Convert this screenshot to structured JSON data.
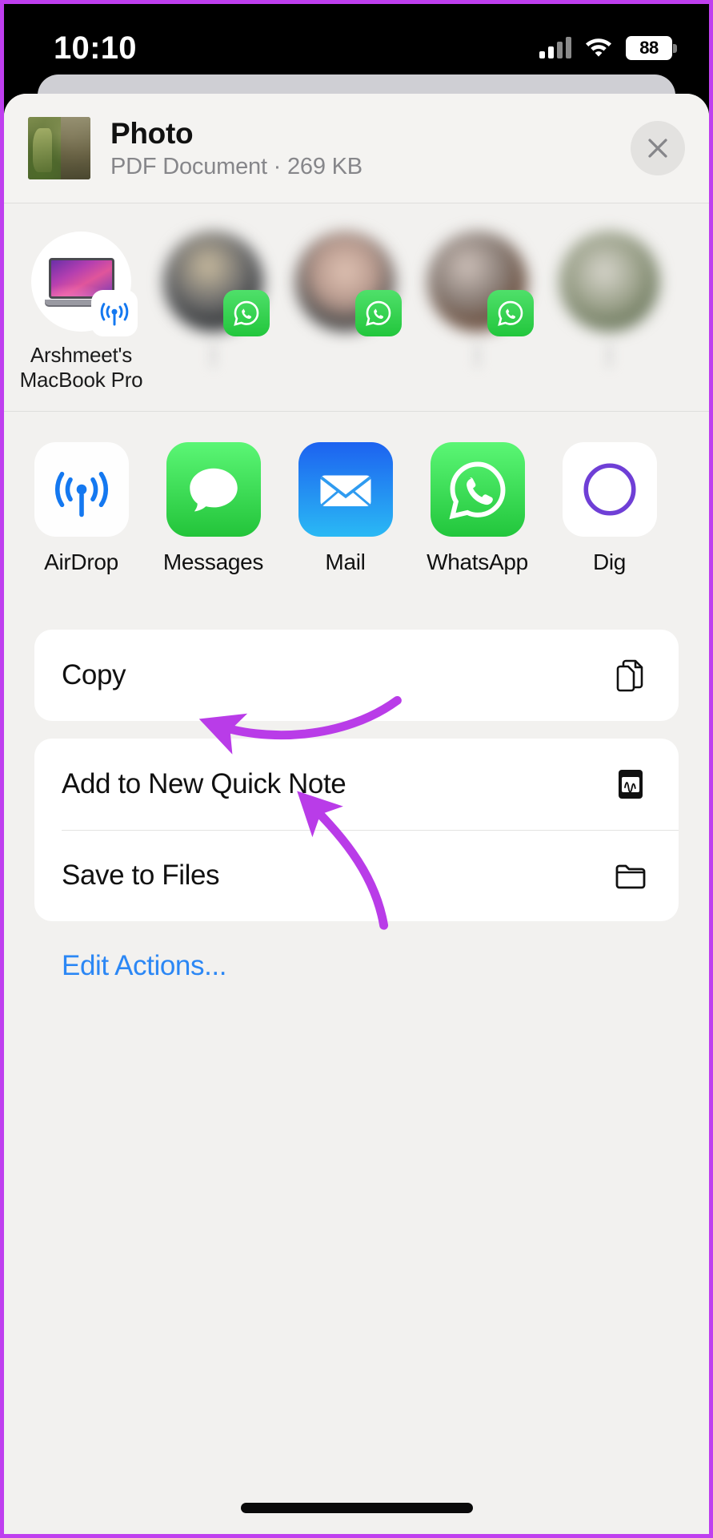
{
  "status_bar": {
    "time": "10:10",
    "battery_percent": "88",
    "cellular_icon": "cellular-signal-icon",
    "wifi_icon": "wifi-icon",
    "battery_icon": "battery-icon"
  },
  "share_sheet": {
    "document": {
      "title": "Photo",
      "subtitle": "PDF Document · 269 KB",
      "thumbnail_icon": "document-thumbnail"
    },
    "close_label": "Close",
    "people": [
      {
        "name": "Arshmeet's MacBook Pro",
        "badge": "airdrop-badge",
        "avatar": "macbook-pro-icon",
        "blurred": false
      },
      {
        "name": "",
        "badge": "whatsapp-badge",
        "avatar": "contact-photo",
        "blurred": true
      },
      {
        "name": "",
        "badge": "whatsapp-badge",
        "avatar": "contact-photo",
        "blurred": true
      },
      {
        "name": "",
        "badge": "whatsapp-badge",
        "avatar": "contact-photo",
        "blurred": true
      },
      {
        "name": "",
        "badge": "whatsapp-badge",
        "avatar": "contact-photo",
        "blurred": true
      }
    ],
    "apps": [
      {
        "label": "AirDrop",
        "icon": "airdrop-icon"
      },
      {
        "label": "Messages",
        "icon": "messages-icon"
      },
      {
        "label": "Mail",
        "icon": "mail-icon"
      },
      {
        "label": "WhatsApp",
        "icon": "whatsapp-icon"
      },
      {
        "label": "Dig",
        "icon": "digital-touch-icon"
      }
    ],
    "action_groups": [
      {
        "rows": [
          {
            "label": "Copy",
            "icon": "copy-documents-icon"
          }
        ]
      },
      {
        "rows": [
          {
            "label": "Add to New Quick Note",
            "icon": "quick-note-icon"
          },
          {
            "label": "Save to Files",
            "icon": "folder-icon"
          }
        ]
      }
    ],
    "edit_actions_label": "Edit Actions..."
  },
  "annotations": {
    "arrow_color": "#b93ce8",
    "arrow_to_copy": "curved arrow pointing to Copy row",
    "arrow_to_save_to_files": "curved arrow pointing to Save to Files row"
  },
  "colors": {
    "accent_blue": "#2b87f5",
    "sheet_background": "#f2f1ef",
    "card_background": "#ffffff",
    "annotation_purple": "#b93ce8",
    "whatsapp_green": "#25d366"
  }
}
